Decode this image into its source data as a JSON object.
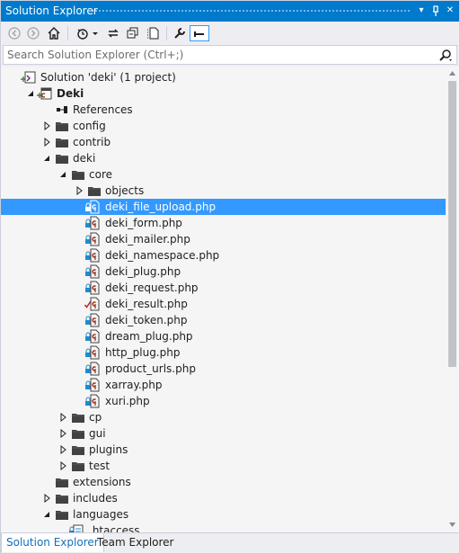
{
  "window": {
    "title": "Solution Explorer",
    "pin_glyph": "⊥",
    "dropdown_glyph": "▾",
    "close_glyph": "✕"
  },
  "toolbar": {
    "icons": [
      "back-icon",
      "forward-icon",
      "home-icon",
      "pending-changes-filter-icon",
      "dropdown-arrow-icon",
      "sync-icon",
      "collapse-all-icon",
      "show-all-files-icon",
      "properties-wrench-icon",
      "preview-selected-icon"
    ]
  },
  "search": {
    "placeholder": "Search Solution Explorer (Ctrl+;)"
  },
  "tree": {
    "items": [
      {
        "label": "Solution 'deki' (1 project)",
        "depth": 0,
        "type": "solution",
        "expander": "none",
        "status": "plus"
      },
      {
        "label": "Deki",
        "depth": 1,
        "type": "project",
        "expander": "expanded",
        "status": "plus",
        "bold": true
      },
      {
        "label": "References",
        "depth": 2,
        "type": "references",
        "expander": "none",
        "status": "none"
      },
      {
        "label": "config",
        "depth": 2,
        "type": "folder",
        "expander": "collapsed",
        "status": "none"
      },
      {
        "label": "contrib",
        "depth": 2,
        "type": "folder",
        "expander": "collapsed",
        "status": "none"
      },
      {
        "label": "deki",
        "depth": 2,
        "type": "folder",
        "expander": "expanded",
        "status": "none"
      },
      {
        "label": "core",
        "depth": 3,
        "type": "folder",
        "expander": "expanded",
        "status": "none"
      },
      {
        "label": "objects",
        "depth": 4,
        "type": "folder",
        "expander": "collapsed",
        "status": "none"
      },
      {
        "label": "deki_file_upload.php",
        "depth": 4,
        "type": "php",
        "expander": "none",
        "status": "lock",
        "selected": true
      },
      {
        "label": "deki_form.php",
        "depth": 4,
        "type": "php",
        "expander": "none",
        "status": "lock"
      },
      {
        "label": "deki_mailer.php",
        "depth": 4,
        "type": "php",
        "expander": "none",
        "status": "lock"
      },
      {
        "label": "deki_namespace.php",
        "depth": 4,
        "type": "php",
        "expander": "none",
        "status": "lock"
      },
      {
        "label": "deki_plug.php",
        "depth": 4,
        "type": "php",
        "expander": "none",
        "status": "lock"
      },
      {
        "label": "deki_request.php",
        "depth": 4,
        "type": "php",
        "expander": "none",
        "status": "lock"
      },
      {
        "label": "deki_result.php",
        "depth": 4,
        "type": "php",
        "expander": "none",
        "status": "check"
      },
      {
        "label": "deki_token.php",
        "depth": 4,
        "type": "php",
        "expander": "none",
        "status": "lock"
      },
      {
        "label": "dream_plug.php",
        "depth": 4,
        "type": "php",
        "expander": "none",
        "status": "lock"
      },
      {
        "label": "http_plug.php",
        "depth": 4,
        "type": "php",
        "expander": "none",
        "status": "lock"
      },
      {
        "label": "product_urls.php",
        "depth": 4,
        "type": "php",
        "expander": "none",
        "status": "lock"
      },
      {
        "label": "xarray.php",
        "depth": 4,
        "type": "php",
        "expander": "none",
        "status": "lock"
      },
      {
        "label": "xuri.php",
        "depth": 4,
        "type": "php",
        "expander": "none",
        "status": "lock"
      },
      {
        "label": "cp",
        "depth": 3,
        "type": "folder",
        "expander": "collapsed",
        "status": "none"
      },
      {
        "label": "gui",
        "depth": 3,
        "type": "folder",
        "expander": "collapsed",
        "status": "none"
      },
      {
        "label": "plugins",
        "depth": 3,
        "type": "folder",
        "expander": "collapsed",
        "status": "none"
      },
      {
        "label": "test",
        "depth": 3,
        "type": "folder",
        "expander": "collapsed",
        "status": "none"
      },
      {
        "label": "extensions",
        "depth": 2,
        "type": "folder",
        "expander": "none",
        "status": "none"
      },
      {
        "label": "includes",
        "depth": 2,
        "type": "folder",
        "expander": "collapsed",
        "status": "none"
      },
      {
        "label": "languages",
        "depth": 2,
        "type": "folder",
        "expander": "expanded",
        "status": "none"
      },
      {
        "label": ".htaccess",
        "depth": 3,
        "type": "config",
        "expander": "none",
        "status": "lock"
      }
    ]
  },
  "tabs": [
    {
      "label": "Solution Explorer",
      "active": true
    },
    {
      "label": "Team Explorer",
      "active": false
    }
  ],
  "colors": {
    "accent": "#007acc",
    "selection": "#3399ff",
    "folder": "#424242",
    "lock_blue": "#1e8bd0",
    "check_red": "#c72020",
    "php_red": "#a1260d"
  }
}
